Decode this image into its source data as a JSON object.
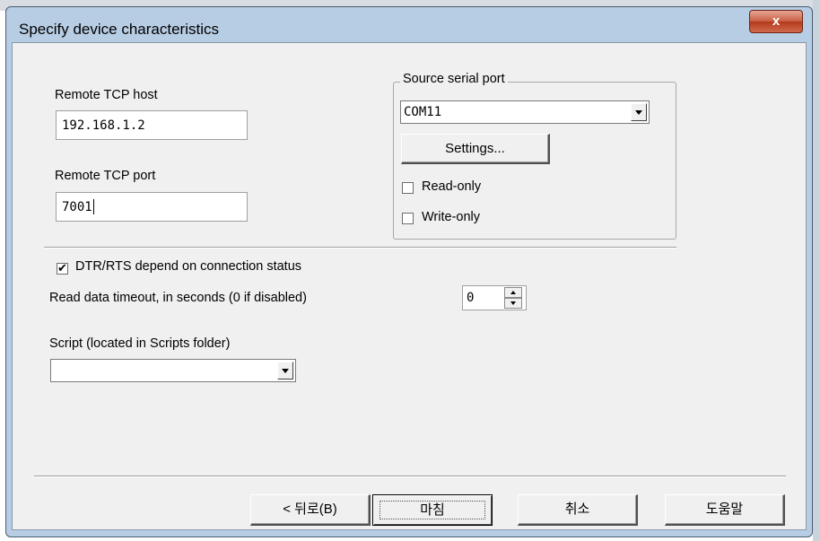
{
  "window": {
    "title": "Specify device characteristics",
    "close_label": "x"
  },
  "remote": {
    "host_label": "Remote TCP host",
    "host_value": "192.168.1.2",
    "port_label": "Remote TCP port",
    "port_value": "7001"
  },
  "source": {
    "group_label": "Source serial port",
    "port_value": "COM11",
    "settings_label": "Settings...",
    "readonly_label": "Read-only",
    "readonly_checked": false,
    "writeonly_label": "Write-only",
    "writeonly_checked": false
  },
  "options": {
    "dtr_label": "DTR/RTS depend on connection status",
    "dtr_checked": true,
    "timeout_label": "Read data timeout, in seconds (0 if disabled)",
    "timeout_value": "0",
    "script_label": "Script (located in Scripts folder)",
    "script_value": ""
  },
  "footer": {
    "back_label": "< 뒤로(B)",
    "finish_label": "마침",
    "cancel_label": "취소",
    "help_label": "도움말"
  }
}
